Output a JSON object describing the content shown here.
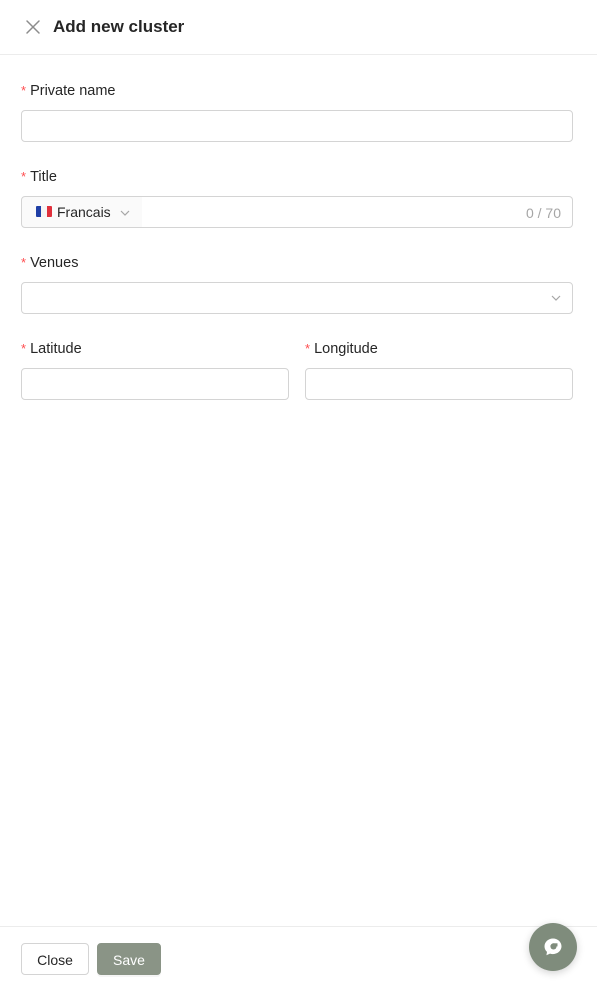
{
  "header": {
    "title": "Add new cluster",
    "close_icon": "close-icon"
  },
  "form": {
    "private_name": {
      "label": "Private name",
      "required_mark": "*",
      "value": ""
    },
    "title": {
      "label": "Title",
      "required_mark": "*",
      "language": "Francais",
      "language_flag": "flag-fr-icon",
      "value": "",
      "counter": "0 / 70"
    },
    "venues": {
      "label": "Venues",
      "required_mark": "*",
      "value": ""
    },
    "latitude": {
      "label": "Latitude",
      "required_mark": "*",
      "value": ""
    },
    "longitude": {
      "label": "Longitude",
      "required_mark": "*",
      "value": ""
    }
  },
  "footer": {
    "close_label": "Close",
    "save_label": "Save"
  },
  "colors": {
    "required": "#ff4d4f",
    "primary_button": "#8a9486",
    "chat_fab": "#7f8c7c",
    "border": "#d4d4d4"
  },
  "chat_widget": {
    "icon": "chat-support-icon"
  }
}
